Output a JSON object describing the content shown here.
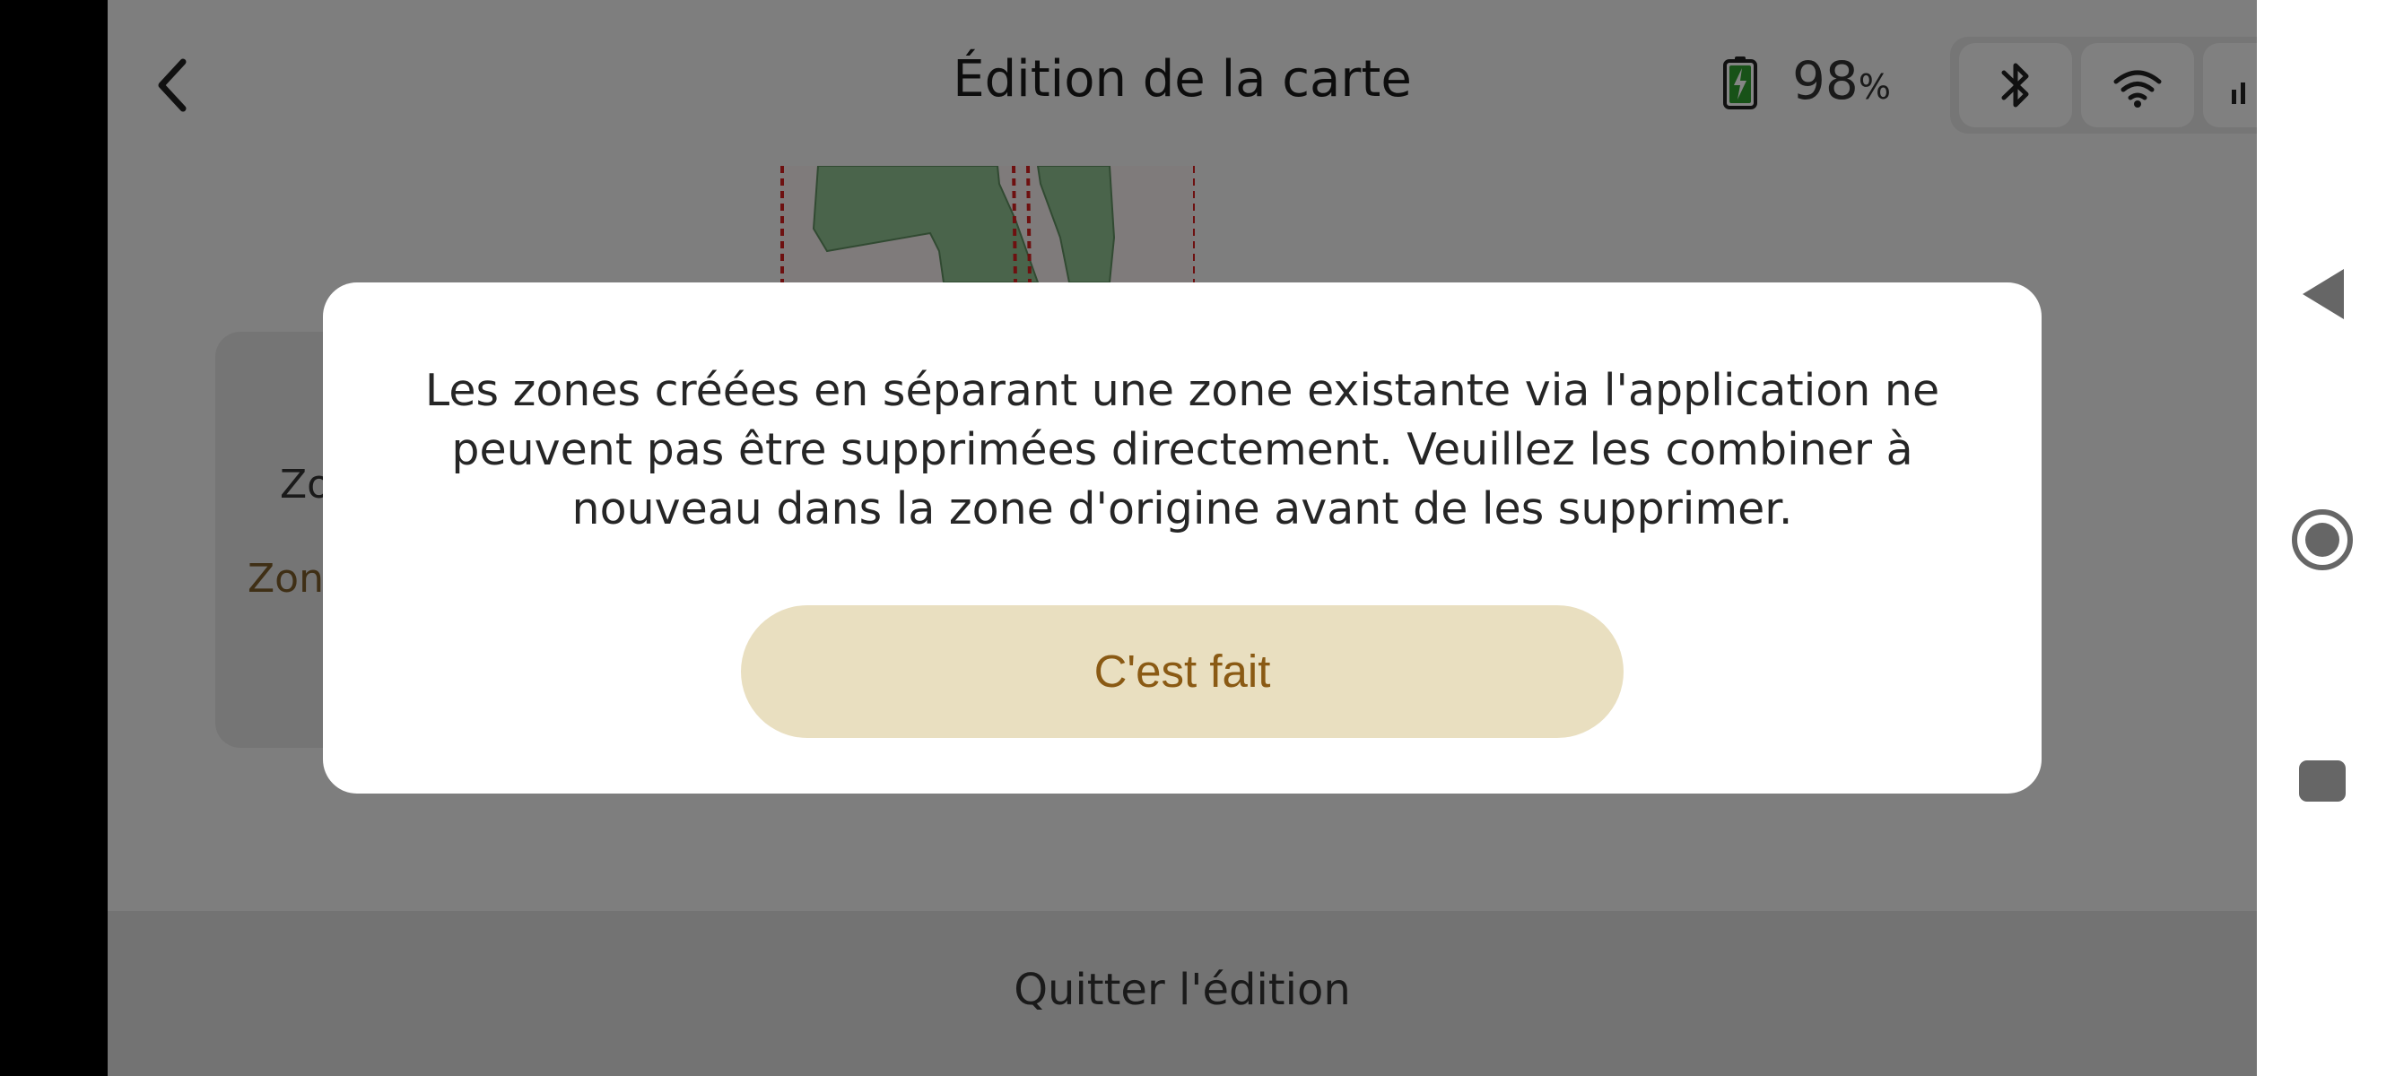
{
  "header": {
    "title": "Édition de la carte",
    "battery_value": "98",
    "battery_unit": "%"
  },
  "icons": {
    "back": "chevron-left-icon",
    "battery": "battery-charging-icon",
    "bluetooth": "bluetooth-icon",
    "wifi": "wifi-icon",
    "signal": "signal-icon"
  },
  "zone_card": {
    "row1_label": "Zo",
    "row2_label": "Zone"
  },
  "dialog": {
    "message": "Les zones créées en séparant une zone existante via l'application ne peuvent pas être supprimées directement. Veuillez les combiner à nouveau dans la zone d'origine avant de les supprimer.",
    "confirm_label": "C'est fait"
  },
  "bottom_bar": {
    "exit_label": "Quitter l'édition"
  },
  "colors": {
    "accent_button_bg": "#e9dfc0",
    "accent_button_text": "#8a5a14",
    "zone_text": "#7a5a2a",
    "map_lawn": "#8fc090",
    "map_boundary": "#d42020",
    "battery_green": "#2f9e2f"
  }
}
